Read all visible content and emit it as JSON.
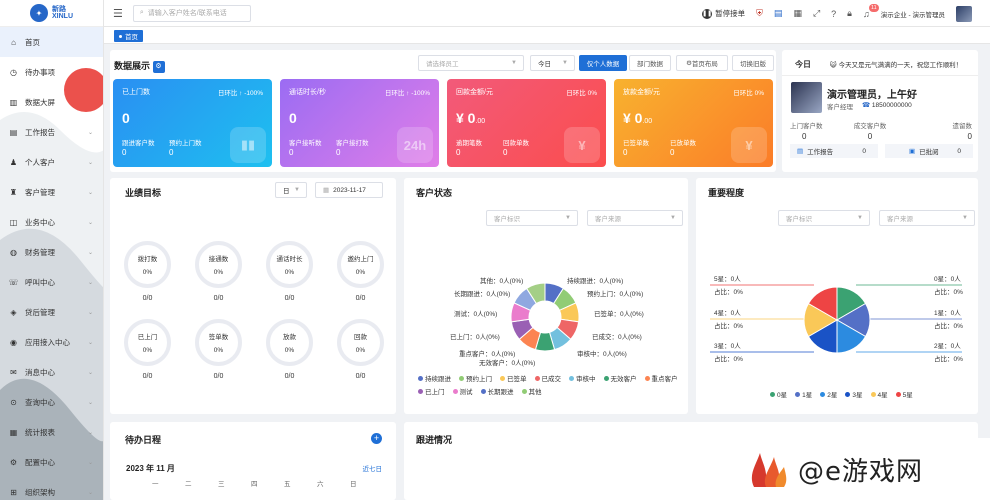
{
  "brand": {
    "name": "新路",
    "sub": "XINLU"
  },
  "sidebar": {
    "items": [
      {
        "label": "首页",
        "icon": "home-icon",
        "active": true
      },
      {
        "label": "待办事项",
        "icon": "clock-icon"
      },
      {
        "label": "数据大屏",
        "icon": "bar-chart-icon"
      },
      {
        "label": "工作报告",
        "icon": "report-icon",
        "chev": true
      },
      {
        "label": "个人客户",
        "icon": "user-icon",
        "chev": true
      },
      {
        "label": "客户管理",
        "icon": "customer-icon",
        "chev": true
      },
      {
        "label": "业务中心",
        "icon": "business-icon",
        "chev": true
      },
      {
        "label": "财务管理",
        "icon": "finance-icon",
        "chev": true
      },
      {
        "label": "呼叫中心",
        "icon": "phone-icon",
        "chev": true
      },
      {
        "label": "贷后管理",
        "icon": "loan-icon",
        "chev": true
      },
      {
        "label": "应用接入中心",
        "icon": "app-icon",
        "chev": true
      },
      {
        "label": "消息中心",
        "icon": "message-icon",
        "chev": true
      },
      {
        "label": "查询中心",
        "icon": "query-icon",
        "chev": true
      },
      {
        "label": "统计报表",
        "icon": "stats-icon",
        "chev": true
      },
      {
        "label": "配置中心",
        "icon": "config-icon",
        "chev": true
      },
      {
        "label": "组织架构",
        "icon": "org-icon",
        "chev": true
      }
    ]
  },
  "topbar": {
    "search_placeholder": "请输入客户姓名/联系电话",
    "pause_label": "暂停接单",
    "notif_count": "11",
    "company": "演示企业 - 演示管理员"
  },
  "tab": {
    "label": "首页"
  },
  "display": {
    "title": "数据展示",
    "employee_placeholder": "请选择员工",
    "date_select": "今日",
    "buttons": [
      "仅个人数据",
      "部门数据",
      "首页布局",
      "切换旧版"
    ]
  },
  "cards": [
    {
      "title": "已上门数",
      "ratio": "日环比 ↑ -100%",
      "value": "0",
      "unit": "",
      "s1_label": "跟进客户数",
      "s1_value": "0",
      "s2_label": "预约上门数",
      "s2_value": "0",
      "deco": "▮▮"
    },
    {
      "title": "通话时长/秒",
      "ratio": "日环比 ↑ -100%",
      "value": "0",
      "unit": "",
      "s1_label": "客户接听数",
      "s1_value": "0",
      "s2_label": "客户接打数",
      "s2_value": "0",
      "deco": "24h"
    },
    {
      "title": "回款金额/元",
      "ratio": "日环比 0%",
      "value": "¥ 0",
      "unit": ".00",
      "s1_label": "逾期笔数",
      "s1_value": "0",
      "s2_label": "回款单数",
      "s2_value": "0",
      "deco": "¥"
    },
    {
      "title": "放款金额/元",
      "ratio": "日环比 0%",
      "value": "¥ 0",
      "unit": ".00",
      "s1_label": "已签单数",
      "s1_value": "0",
      "s2_label": "已放单数",
      "s2_value": "0",
      "deco": "¥"
    }
  ],
  "today": {
    "label": "今日",
    "motto": "😺 今天又是元气满满的一天，祝您工作顺利！",
    "greeting": "演示管理员，上午好",
    "role": "客户经理",
    "phone": "18500000000",
    "stats": [
      {
        "label": "上门客户数",
        "value": "0"
      },
      {
        "label": "成交客户数",
        "value": "0"
      },
      {
        "label": "遗留数",
        "value": "0"
      }
    ],
    "links": [
      {
        "label": "工作报告",
        "value": "0"
      },
      {
        "label": "已批阅",
        "value": "0"
      }
    ]
  },
  "goals": {
    "title": "业绩目标",
    "period": "日",
    "date": "2023-11-17",
    "items": [
      {
        "label": "拨打数",
        "pct": "0%",
        "value": "0/0"
      },
      {
        "label": "接通数",
        "pct": "0%",
        "value": "0/0"
      },
      {
        "label": "通话时长",
        "pct": "0%",
        "value": "0/0"
      },
      {
        "label": "邀约上门",
        "pct": "0%",
        "value": "0/0"
      },
      {
        "label": "已上门",
        "pct": "0%",
        "value": "0/0"
      },
      {
        "label": "签单数",
        "pct": "0%",
        "value": "0/0"
      },
      {
        "label": "放款",
        "pct": "0%",
        "value": "0/0"
      },
      {
        "label": "回款",
        "pct": "0%",
        "value": "0/0"
      }
    ]
  },
  "status": {
    "title": "客户状态",
    "filter1": "客户标识",
    "filter2": "客户来源",
    "labels": [
      "其他：0人(0%)",
      "持续跟进：0人(0%)",
      "长期跟进：0人(0%)",
      "预约上门：0人(0%)",
      "测试：0人(0%)",
      "已签单：0人(0%)",
      "已上门：0人(0%)",
      "已成交：0人(0%)",
      "重点客户：0人(0%)",
      "审核中：0人(0%)",
      "无效客户：0人(0%)"
    ],
    "legend": [
      {
        "name": "持续跟进",
        "color": "#5470c6"
      },
      {
        "name": "预约上门",
        "color": "#91cc75"
      },
      {
        "name": "已签单",
        "color": "#fac858"
      },
      {
        "name": "已成交",
        "color": "#ee6666"
      },
      {
        "name": "审核中",
        "color": "#73c0de"
      },
      {
        "name": "无效客户",
        "color": "#3ba272"
      },
      {
        "name": "重点客户",
        "color": "#fc8452"
      },
      {
        "name": "已上门",
        "color": "#9a60b4"
      },
      {
        "name": "测试",
        "color": "#ea7ccc"
      },
      {
        "name": "长期跟进",
        "color": "#5470c6"
      },
      {
        "name": "其他",
        "color": "#91cc75"
      }
    ]
  },
  "importance": {
    "title": "重要程度",
    "filter1": "客户标识",
    "filter2": "客户来源",
    "left_labels": [
      {
        "a": "5星：0人",
        "b": "占比：0%"
      },
      {
        "a": "4星：0人",
        "b": "占比：0%"
      },
      {
        "a": "3星：0人",
        "b": "占比：0%"
      }
    ],
    "right_labels": [
      {
        "a": "0星：0人",
        "b": "占比：0%"
      },
      {
        "a": "1星：0人",
        "b": "占比：0%"
      },
      {
        "a": "2星：0人",
        "b": "占比：0%"
      }
    ],
    "legend": [
      {
        "name": "0星",
        "color": "#3ba272"
      },
      {
        "name": "1星",
        "color": "#5470c6"
      },
      {
        "name": "2星",
        "color": "#2c8be0"
      },
      {
        "name": "3星",
        "color": "#1a53c6"
      },
      {
        "name": "4星",
        "color": "#fac858"
      },
      {
        "name": "5星",
        "color": "#ee4444"
      }
    ]
  },
  "schedule": {
    "title": "待办日程",
    "month": "2023 年 11 月",
    "link": "近七日",
    "weekdays": [
      "一",
      "二",
      "三",
      "四",
      "五",
      "六",
      "日"
    ]
  },
  "followup": {
    "title": "跟进情况"
  },
  "watermark": {
    "text": "@e游戏网"
  }
}
